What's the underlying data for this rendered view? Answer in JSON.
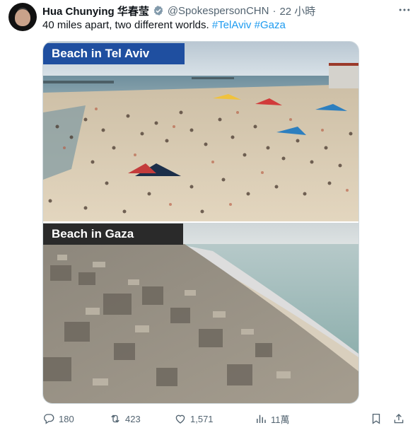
{
  "author": {
    "name": "Hua Chunying 华春莹",
    "handle": "@SpokespersonCHN",
    "separator": "·",
    "time": "22 小時"
  },
  "tweet": {
    "text": "40 miles apart, two different worlds.",
    "hashtags": [
      "#TelAviv",
      "#Gaza"
    ]
  },
  "media": {
    "top_caption": "Beach in Tel Aviv",
    "bottom_caption": "Beach in Gaza"
  },
  "actions": {
    "replies": "180",
    "reposts": "423",
    "likes": "1,571",
    "views": "11萬"
  },
  "colors": {
    "accent": "#1d9bf0",
    "secondary_text": "#536471",
    "caption_blue": "#1f4fa0",
    "caption_dark": "#2a2a2a"
  }
}
